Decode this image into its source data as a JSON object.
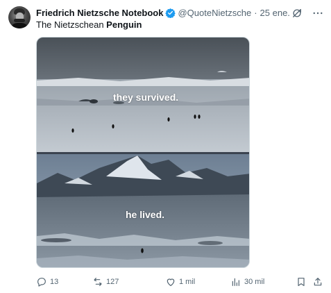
{
  "tweet": {
    "author_name": "Friedrich Nietzsche Notebook",
    "handle": "@QuoteNietzsche",
    "separator": "·",
    "date": "25 ene.",
    "text_plain": "The Nietzschean ",
    "text_bold": "Penguin"
  },
  "media": {
    "caption_top": "they survived.",
    "caption_bottom": "he lived."
  },
  "actions": {
    "replies": "13",
    "reposts": "127",
    "likes": "1 mil",
    "views": "30 mil"
  },
  "icons": {
    "verified": "verified-badge-icon",
    "grok": "grok-icon",
    "more": "more-icon",
    "reply": "reply-icon",
    "repost": "repost-icon",
    "like": "heart-icon",
    "views": "views-icon",
    "bookmark": "bookmark-icon",
    "share": "share-icon"
  },
  "colors": {
    "verified_blue": "#1d9bf0",
    "secondary_text": "#536471"
  }
}
